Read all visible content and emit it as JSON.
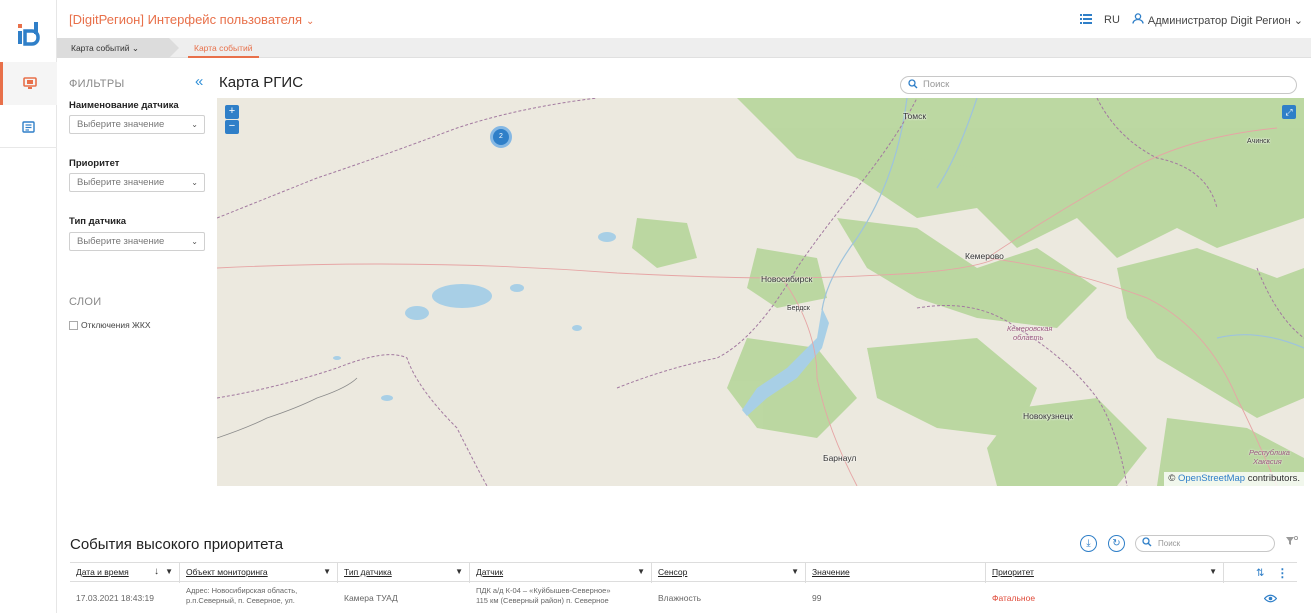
{
  "header": {
    "app_title": "[DigitРегион] Интерфейс пользователя",
    "language": "RU",
    "user": "Администратор Digit Регион"
  },
  "breadcrumb": {
    "parent": "Карта событий",
    "current": "Карта событий"
  },
  "filters": {
    "title": "ФИЛЬТРЫ",
    "sensor_name_label": "Наименование датчика",
    "sensor_name_placeholder": "Выберите значение",
    "priority_label": "Приоритет",
    "priority_placeholder": "Выберите значение",
    "sensor_type_label": "Тип датчика",
    "sensor_type_placeholder": "Выберите значение"
  },
  "layers": {
    "title": "СЛОИ",
    "items": [
      "Отключения ЖКХ"
    ]
  },
  "map": {
    "title": "Карта РГИС",
    "search_placeholder": "Поиск",
    "zoom_in": "+",
    "zoom_out": "−",
    "cluster_count": "2",
    "cities": {
      "tomsk": "Томск",
      "achinsk": "Ачинск",
      "kemerovo": "Кемерово",
      "novosibirsk": "Новосибирск",
      "berdsk": "Бердск",
      "novokuznetsk": "Новокузнецк",
      "barnaul": "Барнаул"
    },
    "regions": {
      "kemerovo_oblast_1": "Кемеровская",
      "kemerovo_oblast_2": "область",
      "khakassia_1": "Республика",
      "khakassia_2": "Хакасия"
    },
    "attribution_prefix": "©",
    "attribution_link": "OpenStreetMap",
    "attribution_suffix": "contributors."
  },
  "events": {
    "title": "События высокого приоритета",
    "search_placeholder": "Поиск",
    "columns": {
      "datetime": "Дата и время",
      "object": "Объект мониторинга",
      "sensor_type": "Тип датчика",
      "sensor": "Датчик",
      "channel": "Сенсор",
      "value": "Значение",
      "priority": "Приоритет"
    },
    "rows": [
      {
        "datetime": "17.03.2021 18:43:19",
        "object_line1": "Адрес: Новосибирская область,",
        "object_line2": "р.п.Северный, п. Северное, ул.",
        "sensor_type": "Камера ТУАД",
        "sensor_line1": "ПДК а/д К-04 – «Куйбышев-Северное»",
        "sensor_line2": "115 км (Северный район) п. Северное",
        "channel": "Влажность",
        "value": "99",
        "priority": "Фатальное"
      }
    ]
  },
  "colors": {
    "accent": "#e8704a",
    "link": "#2f7fc8",
    "fatal": "#e04b3a"
  }
}
